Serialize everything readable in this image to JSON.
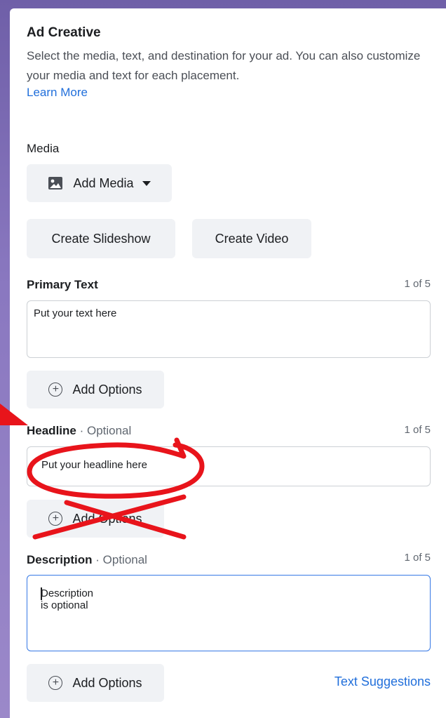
{
  "ad_creative": {
    "title": "Ad Creative",
    "description": "Select the media, text, and destination for your ad. You can also customize your media and text for each placement.",
    "learn_more": "Learn More"
  },
  "media": {
    "label": "Media",
    "add_media": "Add Media",
    "create_slideshow": "Create Slideshow",
    "create_video": "Create Video"
  },
  "primary_text": {
    "label": "Primary Text",
    "counter": "1 of 5",
    "value": "Put your text here",
    "add_options": "Add Options"
  },
  "headline": {
    "label": "Headline",
    "optional": " · Optional",
    "counter": "1 of 5",
    "value": "Put your headline here",
    "add_options": "Add Options"
  },
  "description": {
    "label": "Description",
    "optional": " · Optional",
    "counter": "1 of 5",
    "value": "Description is optional",
    "add_options": "Add Options",
    "text_suggestions": "Text Suggestions"
  },
  "annotations": {
    "arrow_color": "#e8141b",
    "circle_color": "#e8141b",
    "cross_color": "#e8141b"
  }
}
